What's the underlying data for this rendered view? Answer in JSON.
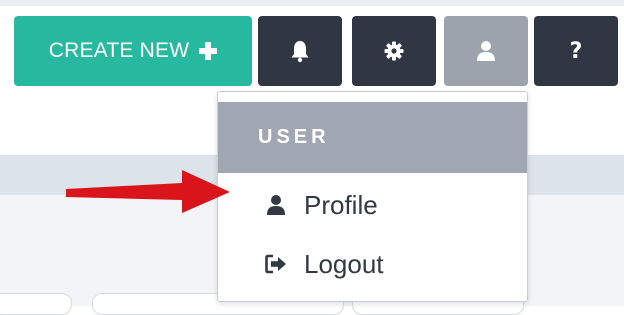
{
  "toolbar": {
    "create_label": "CREATE NEW",
    "create_icon": "plus-icon",
    "notifications_icon": "bell-icon",
    "settings_icon": "gear-icon",
    "user_icon": "user-icon",
    "help_icon": "question-icon",
    "help_glyph": "?"
  },
  "user_menu": {
    "header": "USER",
    "items": [
      {
        "label": "Profile",
        "icon": "user-icon"
      },
      {
        "label": "Logout",
        "icon": "sign-out-icon"
      }
    ]
  },
  "annotation": {
    "icon": "red-arrow-icon",
    "color": "#d9141b"
  },
  "colors": {
    "accent": "#26b9a0",
    "dark_button": "#303642",
    "user_button": "#9ca3ad",
    "menu_header": "#a0a7b2"
  }
}
